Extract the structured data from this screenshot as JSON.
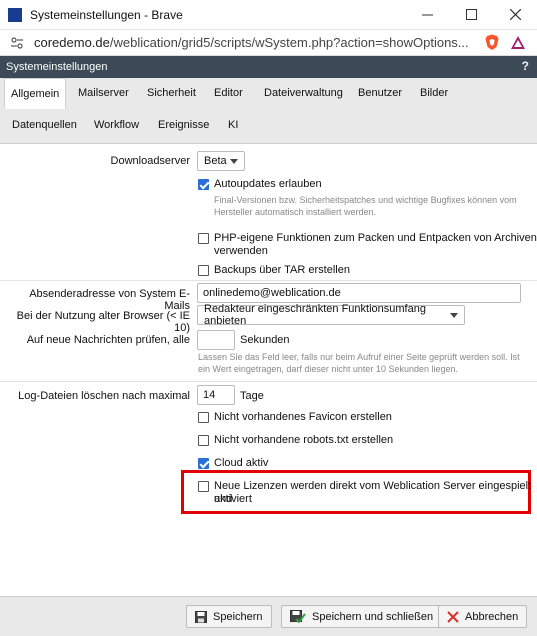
{
  "window": {
    "title": "Systemeinstellungen - Brave"
  },
  "urlbar": {
    "host": "coredemo.de",
    "path": "/weblication/grid5/scripts/wSystem.php?action=showOptions..."
  },
  "dialog": {
    "title": "Systemeinstellungen",
    "help": "?"
  },
  "tabs": [
    {
      "label": "Allgemein"
    },
    {
      "label": "Mailserver"
    },
    {
      "label": "Sicherheit"
    },
    {
      "label": "Editor"
    },
    {
      "label": "Dateiverwaltung"
    },
    {
      "label": "Benutzer"
    },
    {
      "label": "Bilder"
    },
    {
      "label": "Datenquellen"
    },
    {
      "label": "Workflow"
    },
    {
      "label": "Ereignisse"
    },
    {
      "label": "KI"
    }
  ],
  "settings": {
    "downloadserver_label": "Downloadserver",
    "downloadserver_value": "Beta",
    "autoupdates_label": "Autoupdates erlauben",
    "autoupdates_hint_1": "Final-Versionen bzw. Sicherheitspatches und wichtige Bugfixes können vom",
    "autoupdates_hint_2": "Hersteller automatisch installiert werden.",
    "php_label_1": "PHP-eigene Funktionen zum Packen und Entpacken von Archiven",
    "php_label_2": "verwenden",
    "backups_label": "Backups über TAR erstellen",
    "sender_label": "Absenderadresse von System E-Mails",
    "sender_value": "onlinedemo@weblication.de",
    "oldbrowser_label": "Bei der Nutzung alter Browser (< IE 10)",
    "oldbrowser_value": "Redakteur eingeschränkten Funktionsumfang anbieten",
    "messages_label": "Auf neue Nachrichten prüfen, alle",
    "messages_value": "",
    "messages_unit": "Sekunden",
    "messages_hint_1": "Lassen Sie das Feld leer, falls nur beim Aufruf einer Seite geprüft werden soll. Ist",
    "messages_hint_2": "ein Wert eingetragen, darf dieser nicht unter 10 Sekunden liegen.",
    "logs_label": "Log-Dateien löschen nach maximal",
    "logs_value": "14",
    "logs_unit": "Tage",
    "favicon_label": "Nicht vorhandenes Favicon erstellen",
    "robots_label": "Nicht vorhandene robots.txt erstellen",
    "cloud_label": "Cloud aktiv",
    "licenses_label_1": "Neue Lizenzen werden direkt vom Weblication Server eingespielt und",
    "licenses_label_2": "aktiviert"
  },
  "footer": {
    "save_label": "Speichern",
    "save_close_label": "Speichern und schließen",
    "cancel_label": "Abbrechen"
  }
}
